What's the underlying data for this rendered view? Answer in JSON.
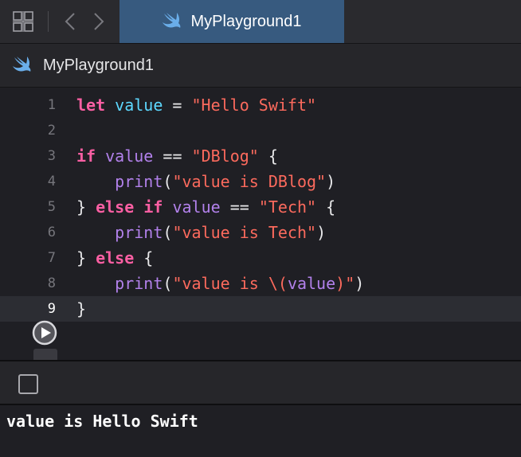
{
  "window": {
    "tab_title": "MyPlayground1",
    "breadcrumb_title": "MyPlayground1"
  },
  "icons": {
    "grid": "grid-icon",
    "back": "chevron-left-icon",
    "forward": "chevron-right-icon",
    "swift": "swift-icon",
    "run": "play-icon",
    "console_toggle": "checkbox-icon"
  },
  "colors": {
    "active_tab": "#375a7f",
    "keyword": "#fc5fa3",
    "variable": "#5dd8ff",
    "variable_ref": "#b281eb",
    "string": "#fc6a5d",
    "function": "#b281eb",
    "swift_icon": "#6aaeea"
  },
  "editor": {
    "current_line": 9,
    "lines": [
      {
        "num": "1",
        "tokens": [
          {
            "t": "let",
            "c": "kw"
          },
          {
            "t": " ",
            "c": ""
          },
          {
            "t": "value",
            "c": "vr"
          },
          {
            "t": " = ",
            "c": ""
          },
          {
            "t": "\"Hello Swift\"",
            "c": "st"
          }
        ]
      },
      {
        "num": "2",
        "tokens": []
      },
      {
        "num": "3",
        "tokens": [
          {
            "t": "if",
            "c": "kw"
          },
          {
            "t": " ",
            "c": ""
          },
          {
            "t": "value",
            "c": "vp"
          },
          {
            "t": " == ",
            "c": ""
          },
          {
            "t": "\"DBlog\"",
            "c": "st"
          },
          {
            "t": " {",
            "c": ""
          }
        ]
      },
      {
        "num": "4",
        "tokens": [
          {
            "t": "    ",
            "c": ""
          },
          {
            "t": "print",
            "c": "fn"
          },
          {
            "t": "(",
            "c": ""
          },
          {
            "t": "\"value is DBlog\"",
            "c": "st"
          },
          {
            "t": ")",
            "c": ""
          }
        ]
      },
      {
        "num": "5",
        "tokens": [
          {
            "t": "} ",
            "c": ""
          },
          {
            "t": "else",
            "c": "kw"
          },
          {
            "t": " ",
            "c": ""
          },
          {
            "t": "if",
            "c": "kw"
          },
          {
            "t": " ",
            "c": ""
          },
          {
            "t": "value",
            "c": "vp"
          },
          {
            "t": " == ",
            "c": ""
          },
          {
            "t": "\"Tech\"",
            "c": "st"
          },
          {
            "t": " {",
            "c": ""
          }
        ]
      },
      {
        "num": "6",
        "tokens": [
          {
            "t": "    ",
            "c": ""
          },
          {
            "t": "print",
            "c": "fn"
          },
          {
            "t": "(",
            "c": ""
          },
          {
            "t": "\"value is Tech\"",
            "c": "st"
          },
          {
            "t": ")",
            "c": ""
          }
        ]
      },
      {
        "num": "7",
        "tokens": [
          {
            "t": "} ",
            "c": ""
          },
          {
            "t": "else",
            "c": "kw"
          },
          {
            "t": " {",
            "c": ""
          }
        ]
      },
      {
        "num": "8",
        "tokens": [
          {
            "t": "    ",
            "c": ""
          },
          {
            "t": "print",
            "c": "fn"
          },
          {
            "t": "(",
            "c": ""
          },
          {
            "t": "\"value is \\(",
            "c": "st"
          },
          {
            "t": "value",
            "c": "vp"
          },
          {
            "t": ")\"",
            "c": "st"
          },
          {
            "t": ")",
            "c": ""
          }
        ]
      },
      {
        "num": "9",
        "tokens": [
          {
            "t": "}",
            "c": ""
          }
        ]
      }
    ]
  },
  "console": {
    "output": "value is Hello Swift"
  }
}
